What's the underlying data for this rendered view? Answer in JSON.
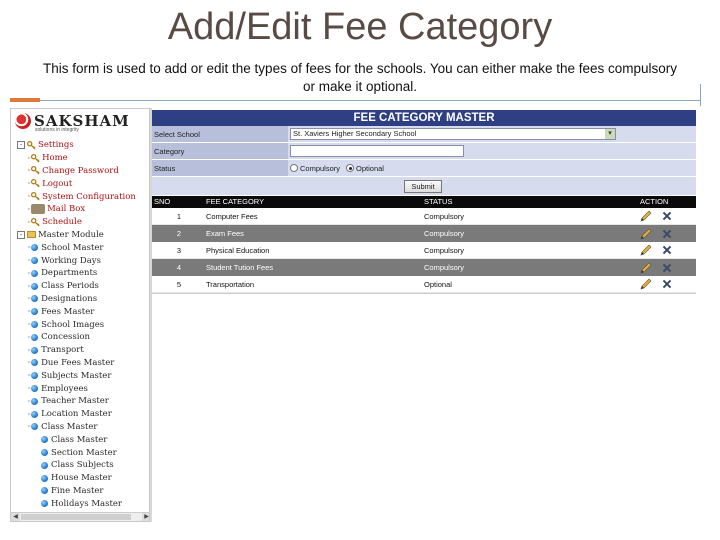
{
  "slide": {
    "title": "Add/Edit Fee Category",
    "description": "This form is used to add or edit the types of fees for the schools. You can either make the fees compulsory or make it optional."
  },
  "app": {
    "logo_text": "SAKSHAM",
    "logo_sub": "solutions in integrity"
  },
  "sidebar": {
    "items": [
      {
        "label": "Settings",
        "level": 0,
        "type": "folder-key",
        "expander": "-"
      },
      {
        "label": "Home",
        "level": 1,
        "type": "key"
      },
      {
        "label": "Change Password",
        "level": 1,
        "type": "key"
      },
      {
        "label": "Logout",
        "level": 1,
        "type": "key"
      },
      {
        "label": "System Configuration",
        "level": 1,
        "type": "key"
      },
      {
        "label": "Mail Box",
        "level": 1,
        "type": "mail"
      },
      {
        "label": "Schedule",
        "level": 1,
        "type": "key"
      },
      {
        "label": "Master Module",
        "level": 0,
        "type": "folder",
        "expander": "-"
      },
      {
        "label": "School Master",
        "level": 1,
        "type": "ball"
      },
      {
        "label": "Working Days",
        "level": 1,
        "type": "ball"
      },
      {
        "label": "Departments",
        "level": 1,
        "type": "ball"
      },
      {
        "label": "Class Periods",
        "level": 1,
        "type": "ball"
      },
      {
        "label": "Designations",
        "level": 1,
        "type": "ball"
      },
      {
        "label": "Fees Master",
        "level": 1,
        "type": "ball"
      },
      {
        "label": "School Images",
        "level": 1,
        "type": "ball"
      },
      {
        "label": "Concession",
        "level": 1,
        "type": "ball"
      },
      {
        "label": "Transport",
        "level": 1,
        "type": "ball"
      },
      {
        "label": "Due Fees Master",
        "level": 1,
        "type": "ball"
      },
      {
        "label": "Subjects Master",
        "level": 1,
        "type": "ball"
      },
      {
        "label": "Employees",
        "level": 1,
        "type": "ball"
      },
      {
        "label": "Teacher Master",
        "level": 1,
        "type": "ball"
      },
      {
        "label": "Location Master",
        "level": 1,
        "type": "ball"
      },
      {
        "label": "Class Master",
        "level": 1,
        "type": "ball"
      },
      {
        "label": "Class Master",
        "level": 2,
        "type": "ball"
      },
      {
        "label": "Section Master",
        "level": 2,
        "type": "ball"
      },
      {
        "label": "Class Subjects",
        "level": 2,
        "type": "ball"
      },
      {
        "label": "House Master",
        "level": 2,
        "type": "ball"
      },
      {
        "label": "Fine Master",
        "level": 2,
        "type": "ball"
      },
      {
        "label": "Holidays Master",
        "level": 2,
        "type": "ball"
      }
    ]
  },
  "form": {
    "header": "FEE CATEGORY MASTER",
    "school_label": "Select School",
    "school_value": "St. Xaviers Higher Secondary School",
    "category_label": "Category",
    "category_value": "",
    "status_label": "Status",
    "status_options": [
      "Compulsory",
      "Optional"
    ],
    "status_selected": "Optional",
    "submit_label": "Submit"
  },
  "table": {
    "columns": [
      "SNO",
      "FEE CATEGORY",
      "STATUS",
      "ACTION"
    ],
    "rows": [
      {
        "sno": "1",
        "category": "Computer Fees",
        "status": "Compulsory"
      },
      {
        "sno": "2",
        "category": "Exam Fees",
        "status": "Compulsory"
      },
      {
        "sno": "3",
        "category": "Physical Education",
        "status": "Compulsory"
      },
      {
        "sno": "4",
        "category": "Student Tution Fees",
        "status": "Compulsory"
      },
      {
        "sno": "5",
        "category": "Transportation",
        "status": "Optional"
      }
    ]
  }
}
